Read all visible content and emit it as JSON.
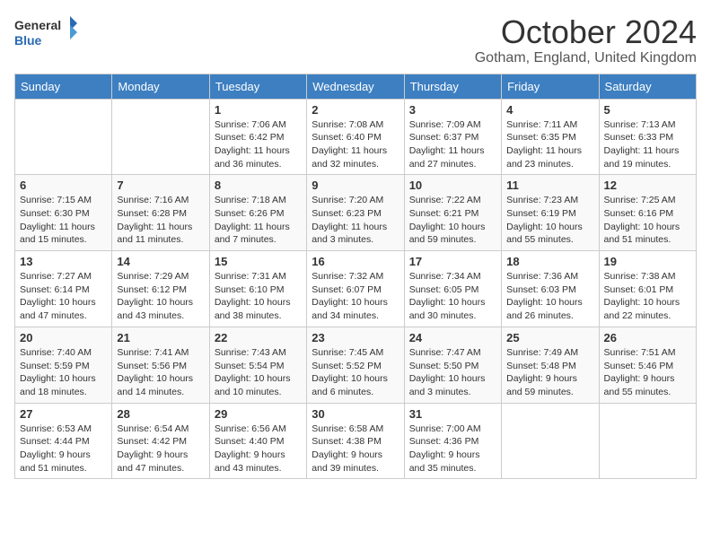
{
  "logo": {
    "line1": "General",
    "line2": "Blue"
  },
  "title": "October 2024",
  "subtitle": "Gotham, England, United Kingdom",
  "headers": [
    "Sunday",
    "Monday",
    "Tuesday",
    "Wednesday",
    "Thursday",
    "Friday",
    "Saturday"
  ],
  "weeks": [
    [
      {
        "day": "",
        "info": ""
      },
      {
        "day": "",
        "info": ""
      },
      {
        "day": "1",
        "info": "Sunrise: 7:06 AM\nSunset: 6:42 PM\nDaylight: 11 hours and 36 minutes."
      },
      {
        "day": "2",
        "info": "Sunrise: 7:08 AM\nSunset: 6:40 PM\nDaylight: 11 hours and 32 minutes."
      },
      {
        "day": "3",
        "info": "Sunrise: 7:09 AM\nSunset: 6:37 PM\nDaylight: 11 hours and 27 minutes."
      },
      {
        "day": "4",
        "info": "Sunrise: 7:11 AM\nSunset: 6:35 PM\nDaylight: 11 hours and 23 minutes."
      },
      {
        "day": "5",
        "info": "Sunrise: 7:13 AM\nSunset: 6:33 PM\nDaylight: 11 hours and 19 minutes."
      }
    ],
    [
      {
        "day": "6",
        "info": "Sunrise: 7:15 AM\nSunset: 6:30 PM\nDaylight: 11 hours and 15 minutes."
      },
      {
        "day": "7",
        "info": "Sunrise: 7:16 AM\nSunset: 6:28 PM\nDaylight: 11 hours and 11 minutes."
      },
      {
        "day": "8",
        "info": "Sunrise: 7:18 AM\nSunset: 6:26 PM\nDaylight: 11 hours and 7 minutes."
      },
      {
        "day": "9",
        "info": "Sunrise: 7:20 AM\nSunset: 6:23 PM\nDaylight: 11 hours and 3 minutes."
      },
      {
        "day": "10",
        "info": "Sunrise: 7:22 AM\nSunset: 6:21 PM\nDaylight: 10 hours and 59 minutes."
      },
      {
        "day": "11",
        "info": "Sunrise: 7:23 AM\nSunset: 6:19 PM\nDaylight: 10 hours and 55 minutes."
      },
      {
        "day": "12",
        "info": "Sunrise: 7:25 AM\nSunset: 6:16 PM\nDaylight: 10 hours and 51 minutes."
      }
    ],
    [
      {
        "day": "13",
        "info": "Sunrise: 7:27 AM\nSunset: 6:14 PM\nDaylight: 10 hours and 47 minutes."
      },
      {
        "day": "14",
        "info": "Sunrise: 7:29 AM\nSunset: 6:12 PM\nDaylight: 10 hours and 43 minutes."
      },
      {
        "day": "15",
        "info": "Sunrise: 7:31 AM\nSunset: 6:10 PM\nDaylight: 10 hours and 38 minutes."
      },
      {
        "day": "16",
        "info": "Sunrise: 7:32 AM\nSunset: 6:07 PM\nDaylight: 10 hours and 34 minutes."
      },
      {
        "day": "17",
        "info": "Sunrise: 7:34 AM\nSunset: 6:05 PM\nDaylight: 10 hours and 30 minutes."
      },
      {
        "day": "18",
        "info": "Sunrise: 7:36 AM\nSunset: 6:03 PM\nDaylight: 10 hours and 26 minutes."
      },
      {
        "day": "19",
        "info": "Sunrise: 7:38 AM\nSunset: 6:01 PM\nDaylight: 10 hours and 22 minutes."
      }
    ],
    [
      {
        "day": "20",
        "info": "Sunrise: 7:40 AM\nSunset: 5:59 PM\nDaylight: 10 hours and 18 minutes."
      },
      {
        "day": "21",
        "info": "Sunrise: 7:41 AM\nSunset: 5:56 PM\nDaylight: 10 hours and 14 minutes."
      },
      {
        "day": "22",
        "info": "Sunrise: 7:43 AM\nSunset: 5:54 PM\nDaylight: 10 hours and 10 minutes."
      },
      {
        "day": "23",
        "info": "Sunrise: 7:45 AM\nSunset: 5:52 PM\nDaylight: 10 hours and 6 minutes."
      },
      {
        "day": "24",
        "info": "Sunrise: 7:47 AM\nSunset: 5:50 PM\nDaylight: 10 hours and 3 minutes."
      },
      {
        "day": "25",
        "info": "Sunrise: 7:49 AM\nSunset: 5:48 PM\nDaylight: 9 hours and 59 minutes."
      },
      {
        "day": "26",
        "info": "Sunrise: 7:51 AM\nSunset: 5:46 PM\nDaylight: 9 hours and 55 minutes."
      }
    ],
    [
      {
        "day": "27",
        "info": "Sunrise: 6:53 AM\nSunset: 4:44 PM\nDaylight: 9 hours and 51 minutes."
      },
      {
        "day": "28",
        "info": "Sunrise: 6:54 AM\nSunset: 4:42 PM\nDaylight: 9 hours and 47 minutes."
      },
      {
        "day": "29",
        "info": "Sunrise: 6:56 AM\nSunset: 4:40 PM\nDaylight: 9 hours and 43 minutes."
      },
      {
        "day": "30",
        "info": "Sunrise: 6:58 AM\nSunset: 4:38 PM\nDaylight: 9 hours and 39 minutes."
      },
      {
        "day": "31",
        "info": "Sunrise: 7:00 AM\nSunset: 4:36 PM\nDaylight: 9 hours and 35 minutes."
      },
      {
        "day": "",
        "info": ""
      },
      {
        "day": "",
        "info": ""
      }
    ]
  ],
  "row_classes": [
    "row-light",
    "row-shaded",
    "row-light",
    "row-shaded",
    "row-light"
  ]
}
